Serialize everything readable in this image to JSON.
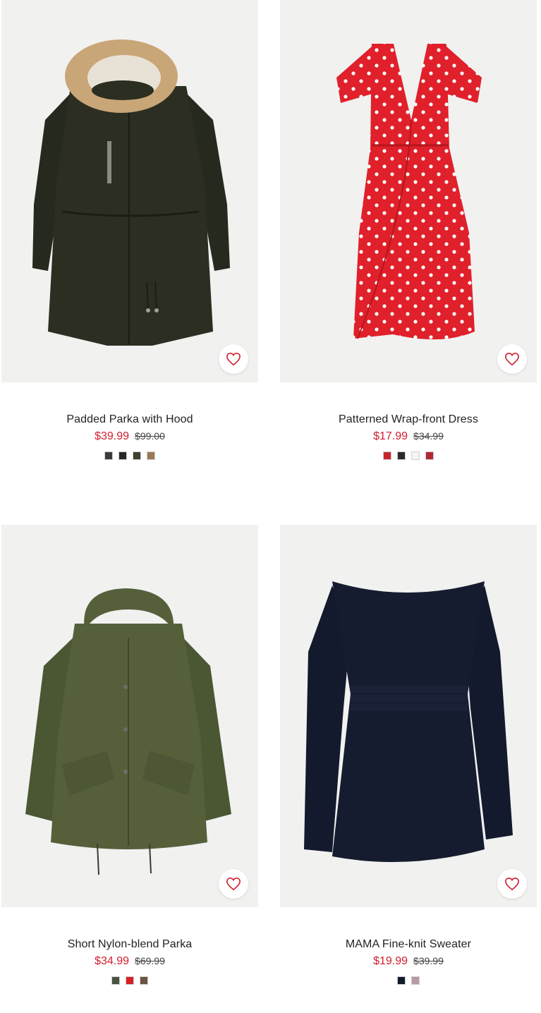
{
  "products": [
    {
      "name": "Padded Parka with Hood",
      "sale_price": "$39.99",
      "original_price": "$99.00",
      "image_icon": "parka-image",
      "swatches": [
        "#3b3b3b",
        "#262626",
        "#3d4130",
        "#9a7a55"
      ]
    },
    {
      "name": "Patterned Wrap-front Dress",
      "sale_price": "$17.99",
      "original_price": "$34.99",
      "image_icon": "dress-image",
      "swatches": [
        "#c8222e",
        "#2a2a2a",
        "#f4f4f4",
        "#b32633"
      ]
    },
    {
      "name": "Short Nylon-blend Parka",
      "sale_price": "$34.99",
      "original_price": "$69.99",
      "image_icon": "jacket-image",
      "swatches": [
        "#4a5240",
        "#d81f26",
        "#6b5540"
      ]
    },
    {
      "name": "MAMA Fine-knit Sweater",
      "sale_price": "$19.99",
      "original_price": "$39.99",
      "image_icon": "sweater-image",
      "swatches": [
        "#141a2e",
        "#b79aa3"
      ]
    }
  ],
  "favorite_icon": "heart-outline-icon",
  "colors": {
    "sale": "#d01e2f",
    "image_background": "#f1f1f0"
  }
}
